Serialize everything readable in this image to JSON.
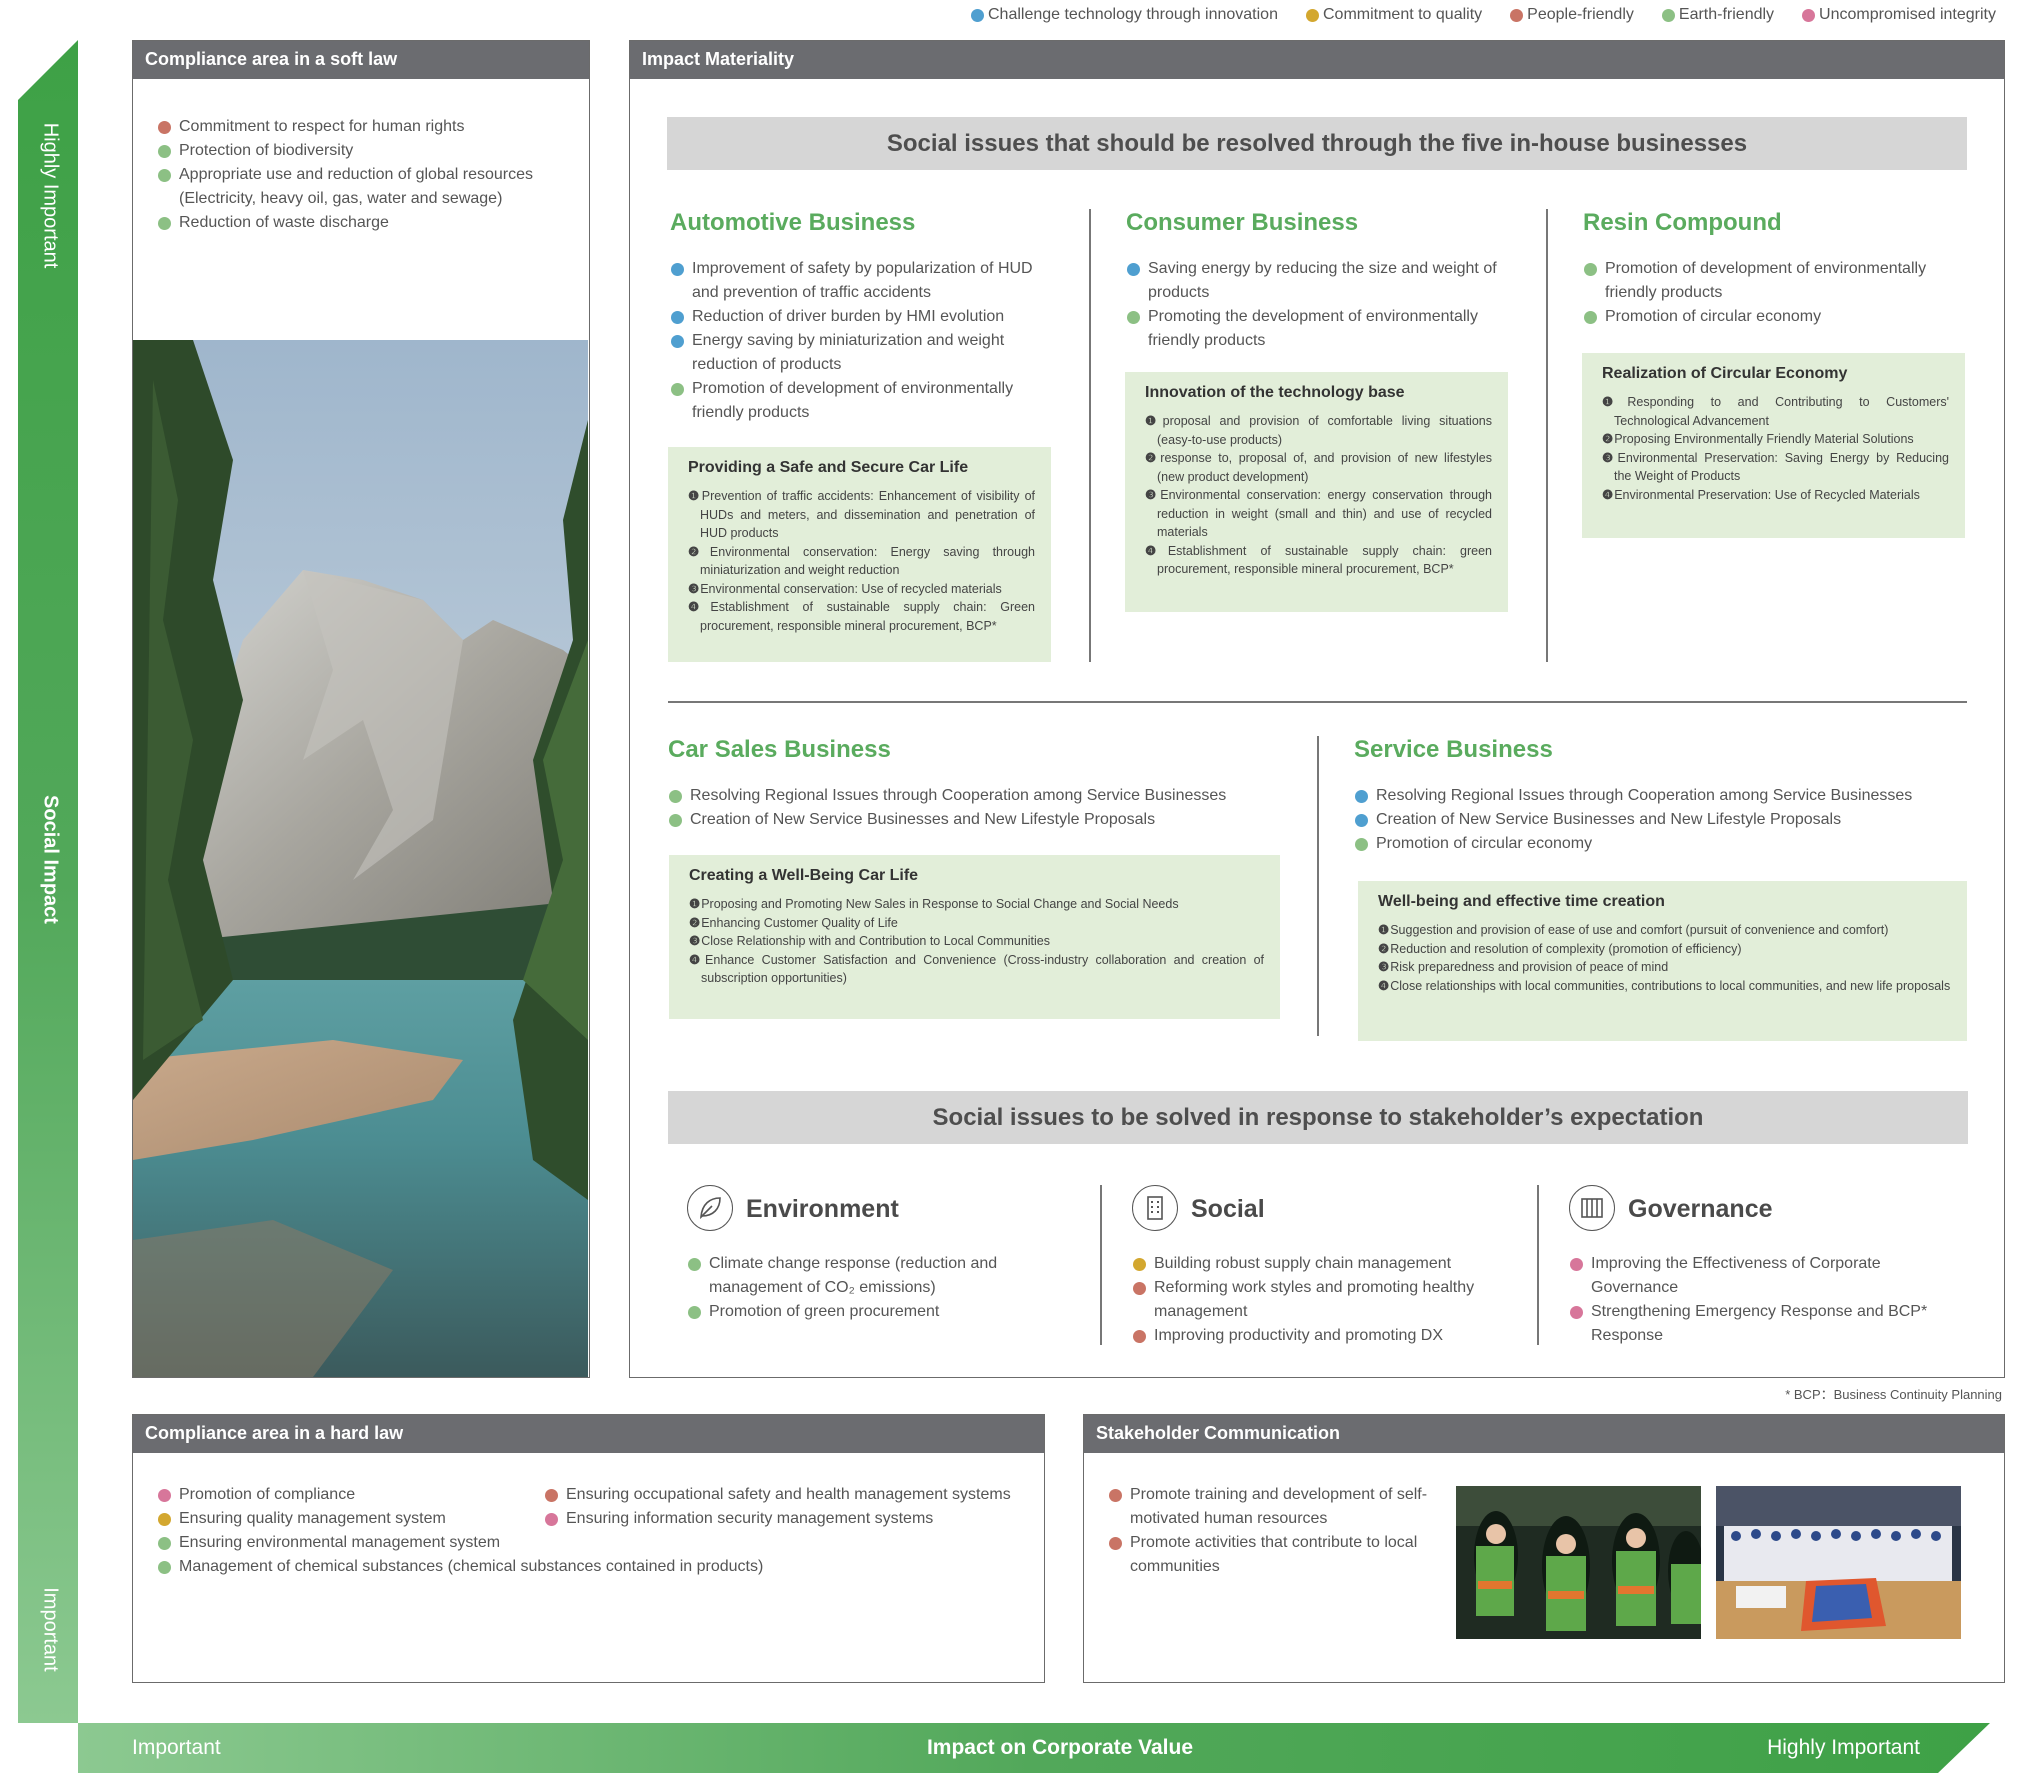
{
  "legend": [
    {
      "label": "Challenge technology through innovation",
      "color": "#4f9fd0"
    },
    {
      "label": "Commitment to quality",
      "color": "#d3a72f"
    },
    {
      "label": "People-friendly",
      "color": "#c97465"
    },
    {
      "label": "Earth-friendly",
      "color": "#8cc084"
    },
    {
      "label": "Uncompromised integrity",
      "color": "#d7769a"
    }
  ],
  "axes": {
    "vertical": {
      "title": "Social Impact",
      "top": "Highly Important",
      "bottom": "Important"
    },
    "horizontal": {
      "title": "Impact on Corporate Value",
      "left": "Important",
      "right": "Highly Important"
    }
  },
  "soft_law": {
    "title": "Compliance area in a soft law",
    "items": [
      {
        "text": "Commitment to respect for human rights",
        "color": "#c97465"
      },
      {
        "text": "Protection of biodiversity",
        "color": "#8cc084"
      },
      {
        "text": "Appropriate use and reduction of global resources (Electricity, heavy oil, gas, water and sewage)",
        "color": "#8cc084"
      },
      {
        "text": "Reduction of waste discharge",
        "color": "#8cc084"
      }
    ]
  },
  "materiality": {
    "title": "Impact Materiality",
    "band1": "Social issues that should be resolved through the five in-house businesses",
    "band2": "Social issues to be solved in response to stakeholder’s expectation",
    "automotive": {
      "title": "Automotive Business",
      "items": [
        {
          "text": "Improvement of safety by popularization of HUD and prevention of traffic accidents",
          "color": "#4f9fd0"
        },
        {
          "text": "Reduction of driver burden by HMI evolution",
          "color": "#4f9fd0"
        },
        {
          "text": "Energy saving by miniaturization and weight reduction of products",
          "color": "#4f9fd0"
        },
        {
          "text": "Promotion of development of environmentally friendly products",
          "color": "#8cc084"
        }
      ],
      "box_title": "Providing a Safe and Secure Car Life",
      "box_items": [
        {
          "num": "❶",
          "text": "Prevention of traffic accidents: Enhancement of visibility of HUDs and meters, and dissemination and penetration of HUD products"
        },
        {
          "num": "❷",
          "text": "Environmental conservation: Energy saving through miniaturization and weight reduction"
        },
        {
          "num": "❸",
          "text": "Environmental conservation: Use of recycled materials"
        },
        {
          "num": "❹",
          "text": "Establishment of sustainable supply chain: Green procurement, responsible mineral procurement, BCP*"
        }
      ]
    },
    "consumer": {
      "title": "Consumer Business",
      "items": [
        {
          "text": "Saving energy by reducing the size and weight of products",
          "color": "#4f9fd0"
        },
        {
          "text": "Promoting the development of environmentally friendly products",
          "color": "#8cc084"
        }
      ],
      "box_title": "Innovation of the technology base",
      "box_items": [
        {
          "num": "❶",
          "text": "proposal and provision of comfortable living situations (easy-to-use products)"
        },
        {
          "num": "❷",
          "text": "response to, proposal of, and provision of new lifestyles (new product development)"
        },
        {
          "num": "❸",
          "text": "Environmental conservation: energy conservation through reduction in weight (small and thin) and use of recycled materials"
        },
        {
          "num": "❹",
          "text": "Establishment of sustainable supply chain: green procurement, responsible mineral procurement, BCP*"
        }
      ]
    },
    "resin": {
      "title": "Resin Compound",
      "items": [
        {
          "text": "Promotion of development of environmentally friendly products",
          "color": "#8cc084"
        },
        {
          "text": "Promotion of circular economy",
          "color": "#8cc084"
        }
      ],
      "box_title": "Realization of Circular Economy",
      "box_items": [
        {
          "num": "❶",
          "text": "Responding to and Contributing to Customers' Technological Advancement"
        },
        {
          "num": "❷",
          "text": "Proposing Environmentally Friendly Material Solutions"
        },
        {
          "num": "❸",
          "text": "Environmental Preservation: Saving Energy by Reducing the Weight of Products"
        },
        {
          "num": "❹",
          "text": "Environmental Preservation: Use of Recycled Materials"
        }
      ]
    },
    "car_sales": {
      "title": "Car Sales Business",
      "items": [
        {
          "text": "Resolving Regional Issues through Cooperation among Service Businesses",
          "color": "#8cc084"
        },
        {
          "text": "Creation of New Service Businesses and New Lifestyle Proposals",
          "color": "#8cc084"
        }
      ],
      "box_title": "Creating a Well-Being Car Life",
      "box_items": [
        {
          "num": "❶",
          "text": "Proposing and Promoting New Sales in Response to Social Change and Social Needs"
        },
        {
          "num": "❷",
          "text": "Enhancing Customer Quality of Life"
        },
        {
          "num": "❸",
          "text": "Close Relationship with and Contribution to Local Communities"
        },
        {
          "num": "❹",
          "text": "Enhance Customer Satisfaction and Convenience (Cross-industry collaboration and creation of subscription opportunities)"
        }
      ]
    },
    "service": {
      "title": "Service Business",
      "items": [
        {
          "text": "Resolving Regional Issues through Cooperation among Service Businesses",
          "color": "#4f9fd0"
        },
        {
          "text": "Creation of New Service Businesses and New Lifestyle Proposals",
          "color": "#4f9fd0"
        },
        {
          "text": "Promotion of circular economy",
          "color": "#8cc084"
        }
      ],
      "box_title": "Well-being and effective time creation",
      "box_items": [
        {
          "num": "❶",
          "text": "Suggestion and provision of ease of use and comfort (pursuit of convenience and comfort)"
        },
        {
          "num": "❷",
          "text": "Reduction and resolution of complexity (promotion of efficiency)"
        },
        {
          "num": "❸",
          "text": "Risk preparedness and provision of peace of mind"
        },
        {
          "num": "❹",
          "text": "Close relationships with local communities, contributions to local communities, and new life proposals"
        }
      ]
    },
    "environment": {
      "title": "Environment",
      "items": [
        {
          "text": "Climate change response (reduction and management of CO₂ emissions)",
          "color": "#8cc084"
        },
        {
          "text": "Promotion of green procurement",
          "color": "#8cc084"
        }
      ]
    },
    "social": {
      "title": "Social",
      "items": [
        {
          "text": "Building robust supply chain management",
          "color": "#d3a72f"
        },
        {
          "text": "Reforming work styles and promoting healthy management",
          "color": "#c97465"
        },
        {
          "text": "Improving productivity and promoting DX",
          "color": "#c97465"
        }
      ]
    },
    "governance": {
      "title": "Governance",
      "items": [
        {
          "text": "Improving the Effectiveness of Corporate Governance",
          "color": "#d7769a"
        },
        {
          "text": "Strengthening Emergency Response and BCP* Response",
          "color": "#d7769a"
        }
      ]
    }
  },
  "footnote": "* BCP：Business Continuity Planning",
  "hard_law": {
    "title": "Compliance area in a hard law",
    "col1": [
      {
        "text": "Promotion of compliance",
        "color": "#d7769a"
      },
      {
        "text": "Ensuring quality management system",
        "color": "#d3a72f"
      },
      {
        "text": "Ensuring environmental management system",
        "color": "#8cc084"
      },
      {
        "text": "Management of chemical substances (chemical substances contained in products)",
        "color": "#8cc084"
      }
    ],
    "col2": [
      {
        "text": "Ensuring occupational safety and health management systems",
        "color": "#c97465"
      },
      {
        "text": "Ensuring information security management systems",
        "color": "#d7769a"
      }
    ]
  },
  "stakeholder": {
    "title": "Stakeholder Communication",
    "items": [
      {
        "text": "Promote training and development of self-motivated human resources",
        "color": "#c97465"
      },
      {
        "text": "Promote activities that contribute to local communities",
        "color": "#c97465"
      }
    ]
  }
}
